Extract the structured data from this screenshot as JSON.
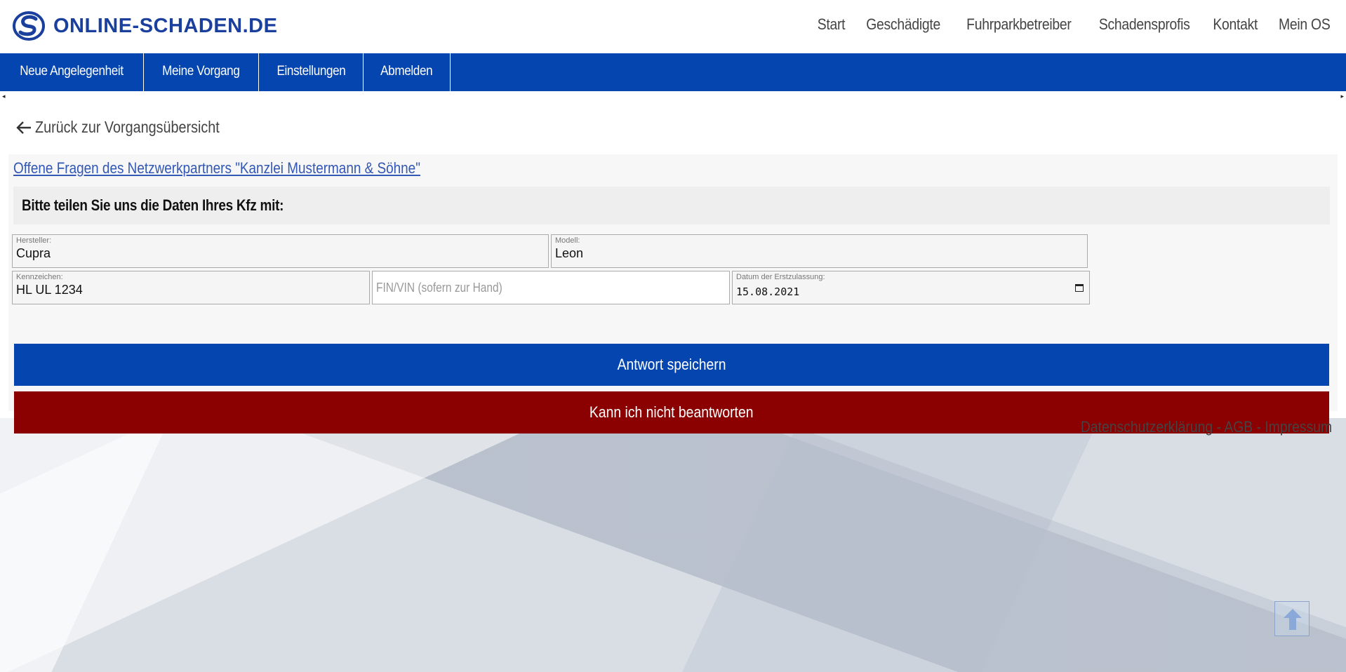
{
  "header": {
    "logo_text": "ONLINE-SCHADEN.DE",
    "nav": [
      "Start",
      "Geschädigte",
      "Fuhrparkbetreiber",
      "Schadensprofis",
      "Kontakt",
      "Mein OS"
    ]
  },
  "menu": [
    "Neue Angelegenheit",
    "Meine Vorgang",
    "Einstellungen",
    "Abmelden"
  ],
  "back_link": "Zurück zur Vorgangsübersicht",
  "partner_link": "Offene Fragen des Netzwerkpartners \"Kanzlei Mustermann & Söhne\"",
  "question": "Bitte teilen Sie uns die Daten Ihres Kfz mit:",
  "form": {
    "manufacturer": {
      "label": "Hersteller:",
      "value": "Cupra"
    },
    "model": {
      "label": "Modell:",
      "value": "Leon"
    },
    "plate": {
      "label": "Kennzeichen:",
      "value": "HL UL 1234"
    },
    "vin": {
      "placeholder": "FIN/VIN (sofern zur Hand)"
    },
    "first_registration": {
      "label": "Datum der Erstzulassung:",
      "value": "15.08.2021"
    }
  },
  "buttons": {
    "save": "Antwort speichern",
    "cannot_answer": "Kann ich nicht beantworten"
  },
  "footer": "Datenschutzerklärung - AGB - Impressum",
  "colors": {
    "brand_blue": "#0445b0",
    "danger_red": "#8b0000",
    "link_blue": "#3357b4"
  }
}
